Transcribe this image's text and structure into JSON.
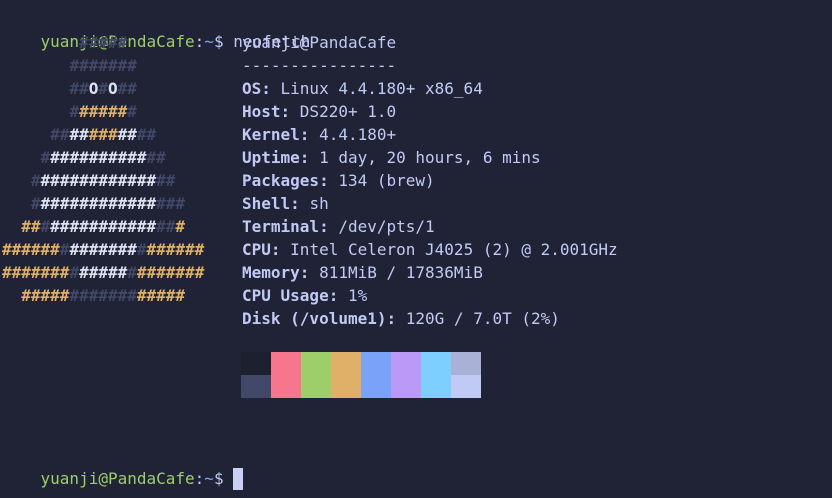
{
  "prompt": {
    "user_host": "yuanji@PandaCafe",
    "colon": ":",
    "path": "~",
    "dollar": "$",
    "command": "neofetch"
  },
  "ascii_art": [
    [
      {
        "t": "        ",
        "c": "dim"
      },
      {
        "t": "#####",
        "c": "dim"
      }
    ],
    [
      {
        "t": "       ",
        "c": "dim"
      },
      {
        "t": "#######",
        "c": "dim"
      }
    ],
    [
      {
        "t": "       ",
        "c": "dim"
      },
      {
        "t": "##",
        "c": "dim"
      },
      {
        "t": "O",
        "c": "white"
      },
      {
        "t": "#",
        "c": "dim"
      },
      {
        "t": "O",
        "c": "white"
      },
      {
        "t": "##",
        "c": "dim"
      }
    ],
    [
      {
        "t": "       ",
        "c": "dim"
      },
      {
        "t": "#",
        "c": "dim"
      },
      {
        "t": "#####",
        "c": "orange"
      },
      {
        "t": "#",
        "c": "dim"
      }
    ],
    [
      {
        "t": "     ",
        "c": "dim"
      },
      {
        "t": "##",
        "c": "dim"
      },
      {
        "t": "##",
        "c": "white"
      },
      {
        "t": "###",
        "c": "orange"
      },
      {
        "t": "##",
        "c": "white"
      },
      {
        "t": "##",
        "c": "dim"
      }
    ],
    [
      {
        "t": "    ",
        "c": "dim"
      },
      {
        "t": "#",
        "c": "dim"
      },
      {
        "t": "##########",
        "c": "white"
      },
      {
        "t": "##",
        "c": "dim"
      }
    ],
    [
      {
        "t": "   ",
        "c": "dim"
      },
      {
        "t": "#",
        "c": "dim"
      },
      {
        "t": "############",
        "c": "white"
      },
      {
        "t": "##",
        "c": "dim"
      }
    ],
    [
      {
        "t": "   ",
        "c": "dim"
      },
      {
        "t": "#",
        "c": "dim"
      },
      {
        "t": "############",
        "c": "white"
      },
      {
        "t": "###",
        "c": "dim"
      }
    ],
    [
      {
        "t": "  ",
        "c": "dim"
      },
      {
        "t": "##",
        "c": "orange"
      },
      {
        "t": "#",
        "c": "dim"
      },
      {
        "t": "###########",
        "c": "white"
      },
      {
        "t": "##",
        "c": "dim"
      },
      {
        "t": "#",
        "c": "orange"
      }
    ],
    [
      {
        "t": "######",
        "c": "orange"
      },
      {
        "t": "#",
        "c": "dim"
      },
      {
        "t": "#######",
        "c": "white"
      },
      {
        "t": "#",
        "c": "dim"
      },
      {
        "t": "######",
        "c": "orange"
      }
    ],
    [
      {
        "t": "#######",
        "c": "orange"
      },
      {
        "t": "#",
        "c": "dim"
      },
      {
        "t": "#####",
        "c": "white"
      },
      {
        "t": "#",
        "c": "dim"
      },
      {
        "t": "#######",
        "c": "orange"
      }
    ],
    [
      {
        "t": "  ",
        "c": "dim"
      },
      {
        "t": "#####",
        "c": "orange"
      },
      {
        "t": "#######",
        "c": "dim"
      },
      {
        "t": "#####",
        "c": "orange"
      }
    ]
  ],
  "info": {
    "title": "yuanji@PandaCafe",
    "separator": "----------------",
    "rows": [
      {
        "key": "OS",
        "value": "Linux 4.4.180+ x86_64"
      },
      {
        "key": "Host",
        "value": "DS220+ 1.0"
      },
      {
        "key": "Kernel",
        "value": "4.4.180+"
      },
      {
        "key": "Uptime",
        "value": "1 day, 20 hours, 6 mins"
      },
      {
        "key": "Packages",
        "value": "134 (brew)"
      },
      {
        "key": "Shell",
        "value": "sh"
      },
      {
        "key": "Terminal",
        "value": "/dev/pts/1"
      },
      {
        "key": "CPU",
        "value": "Intel Celeron J4025 (2) @ 2.001GHz"
      },
      {
        "key": "Memory",
        "value": "811MiB / 17836MiB"
      },
      {
        "key": "CPU Usage",
        "value": "1%"
      },
      {
        "key": "Disk (/volume1)",
        "value": "120G / 7.0T (2%)"
      }
    ]
  },
  "palette": {
    "top": [
      "#1d202f",
      "#f7768e",
      "#9ece6a",
      "#e0af68",
      "#7aa2f7",
      "#bb9af7",
      "#7dcfff",
      "#a9b1d6"
    ],
    "bottom": [
      "#414868",
      "#f7768e",
      "#9ece6a",
      "#e0af68",
      "#7aa2f7",
      "#bb9af7",
      "#7dcfff",
      "#c0caf5"
    ]
  },
  "colors": {
    "background": "#1f2335",
    "user": "#9ece6a",
    "path": "#7aa2f7",
    "art_dim": "#414868",
    "art_white": "#dde1f0",
    "art_orange": "#e0af68"
  }
}
